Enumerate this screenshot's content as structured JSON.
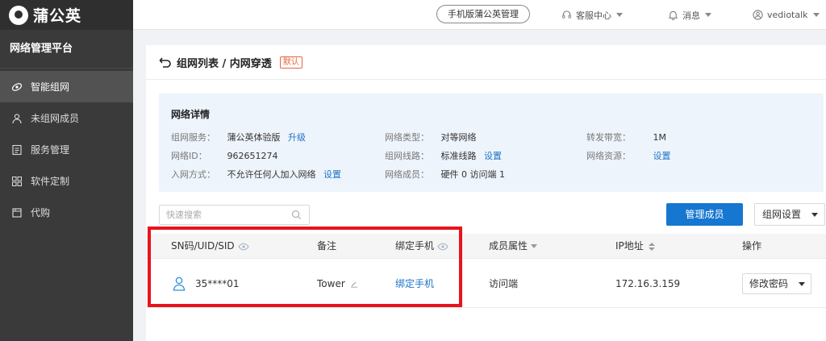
{
  "brand": {
    "name": "蒲公英"
  },
  "sidebar": {
    "title": "网络管理平台",
    "items": [
      {
        "label": "智能组网",
        "icon": "network-icon",
        "active": true
      },
      {
        "label": "未组网成员",
        "icon": "user-icon",
        "active": false
      },
      {
        "label": "服务管理",
        "icon": "document-icon",
        "active": false
      },
      {
        "label": "软件定制",
        "icon": "grid-icon",
        "active": false
      },
      {
        "label": "代购",
        "icon": "order-icon",
        "active": false
      }
    ]
  },
  "topbar": {
    "mobile_button": "手机版蒲公英管理",
    "support": "客服中心",
    "messages": "消息",
    "user": "vediotalk"
  },
  "page": {
    "title": "组网列表 / 内网穿透",
    "badge": "默认"
  },
  "details": {
    "title": "网络详情",
    "service_label": "组网服务：",
    "service_value": "蒲公英体验版",
    "service_link": "升级",
    "network_id_label": "网络ID：",
    "network_id_value": "962651274",
    "join_label": "入网方式：",
    "join_value": "不允许任何人加入网络",
    "join_link": "设置",
    "type_label": "网络类型：",
    "type_value": "对等网络",
    "line_label": "组网线路：",
    "line_value": "标准线路",
    "line_link": "设置",
    "members_label": "网络成员：",
    "members_value": "硬件 0  访问端 1",
    "bandwidth_label": "转发带宽：",
    "bandwidth_value": "1M",
    "resource_label": "网络资源：",
    "resource_link": "设置"
  },
  "search": {
    "placeholder": "快速搜索"
  },
  "actions": {
    "manage_members": "管理成员",
    "network_settings": "组网设置"
  },
  "table": {
    "columns": [
      "SN码/UID/SID",
      "备注",
      "绑定手机",
      "成员属性",
      "IP地址",
      "操作"
    ],
    "rows": [
      {
        "id": "35****01",
        "note": "Tower",
        "bind": "绑定手机",
        "attribute": "访问端",
        "ip": "172.16.3.159",
        "action": "修改密码"
      }
    ]
  },
  "colors": {
    "accent": "#1677d0",
    "highlight": "#e8131b",
    "badge": "#e6663c",
    "sidebar": "#3a3a3a"
  }
}
